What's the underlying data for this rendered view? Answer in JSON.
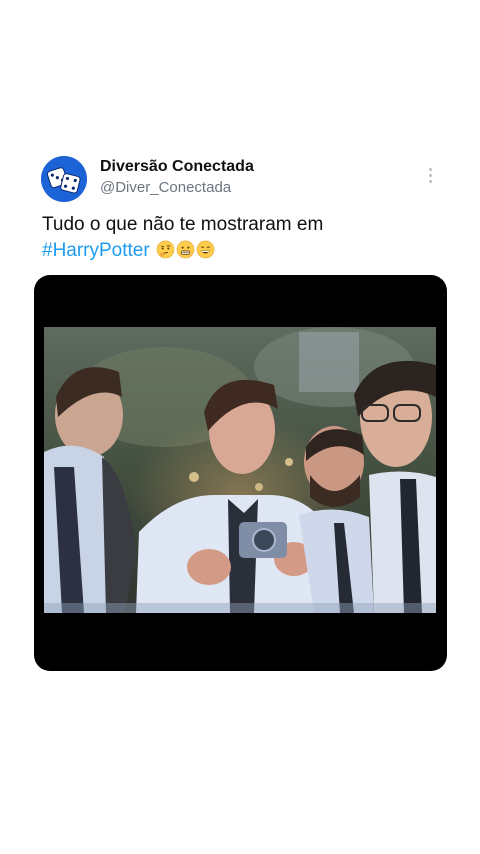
{
  "tweet": {
    "author": {
      "display_name": "Diversão Conectada",
      "handle": "@Diver_Conectada",
      "avatar_icon": "dice-icon",
      "avatar_color": "#1d63d8"
    },
    "text": "Tudo o que não te mostraram em",
    "hashtag": "#HarryPotter",
    "emojis": [
      "thinking-face-icon",
      "grimacing-face-icon",
      "grinning-face-icon"
    ],
    "more_icon": "more-vertical-icon",
    "media": {
      "kind": "video-frame",
      "content": "group-selfie-scene"
    }
  },
  "colors": {
    "hashtag": "#1d9bf0",
    "text": "#111111",
    "handle": "#6b7580"
  }
}
